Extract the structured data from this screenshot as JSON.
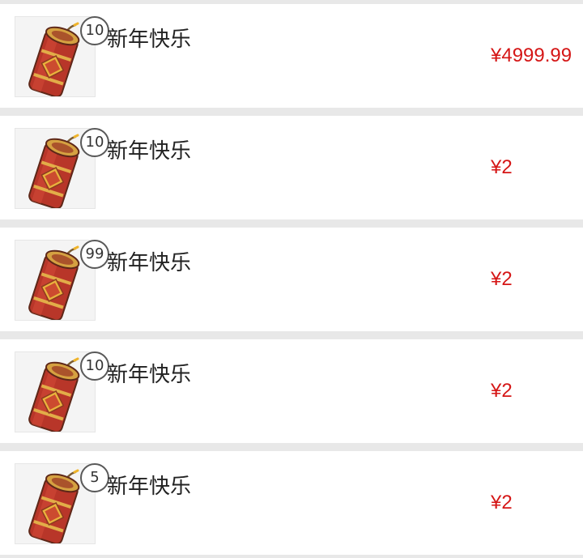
{
  "items": [
    {
      "title": "新年快乐",
      "badge_count": "10",
      "price": "¥4999.99",
      "image_icon": "firecracker-icon"
    },
    {
      "title": "新年快乐",
      "badge_count": "10",
      "price": "¥2",
      "image_icon": "firecracker-icon"
    },
    {
      "title": "新年快乐",
      "badge_count": "99",
      "price": "¥2",
      "image_icon": "firecracker-icon"
    },
    {
      "title": "新年快乐",
      "badge_count": "10",
      "price": "¥2",
      "image_icon": "firecracker-icon"
    },
    {
      "title": "新年快乐",
      "badge_count": "5",
      "price": "¥2",
      "image_icon": "firecracker-icon"
    }
  ],
  "colors": {
    "background": "#e8e8e8",
    "row_background": "#ffffff",
    "price": "#d51616",
    "title": "#222222",
    "badge_border": "#595959"
  }
}
